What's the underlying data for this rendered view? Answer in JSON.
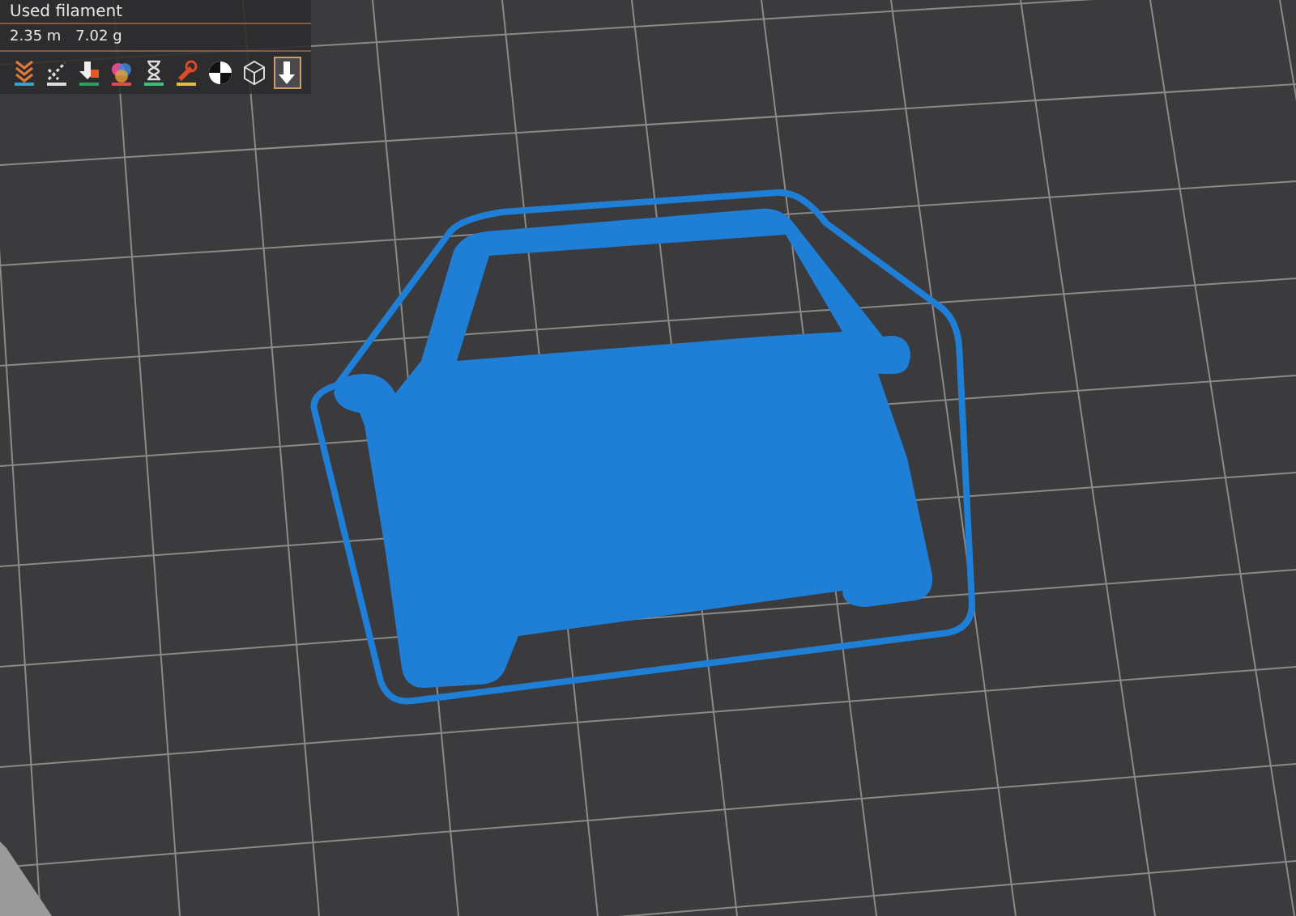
{
  "filament_panel": {
    "title": "Used filament",
    "length": "2.35 m",
    "weight": "7.02 g"
  },
  "toolbar": [
    {
      "kind": "layers",
      "selected": false
    },
    {
      "kind": "travel",
      "selected": false
    },
    {
      "kind": "retract",
      "selected": false
    },
    {
      "kind": "color",
      "selected": false
    },
    {
      "kind": "time",
      "selected": false
    },
    {
      "kind": "tool",
      "selected": false
    },
    {
      "kind": "contrast",
      "selected": false
    },
    {
      "kind": "cube",
      "selected": false
    },
    {
      "kind": "export",
      "selected": true
    }
  ]
}
